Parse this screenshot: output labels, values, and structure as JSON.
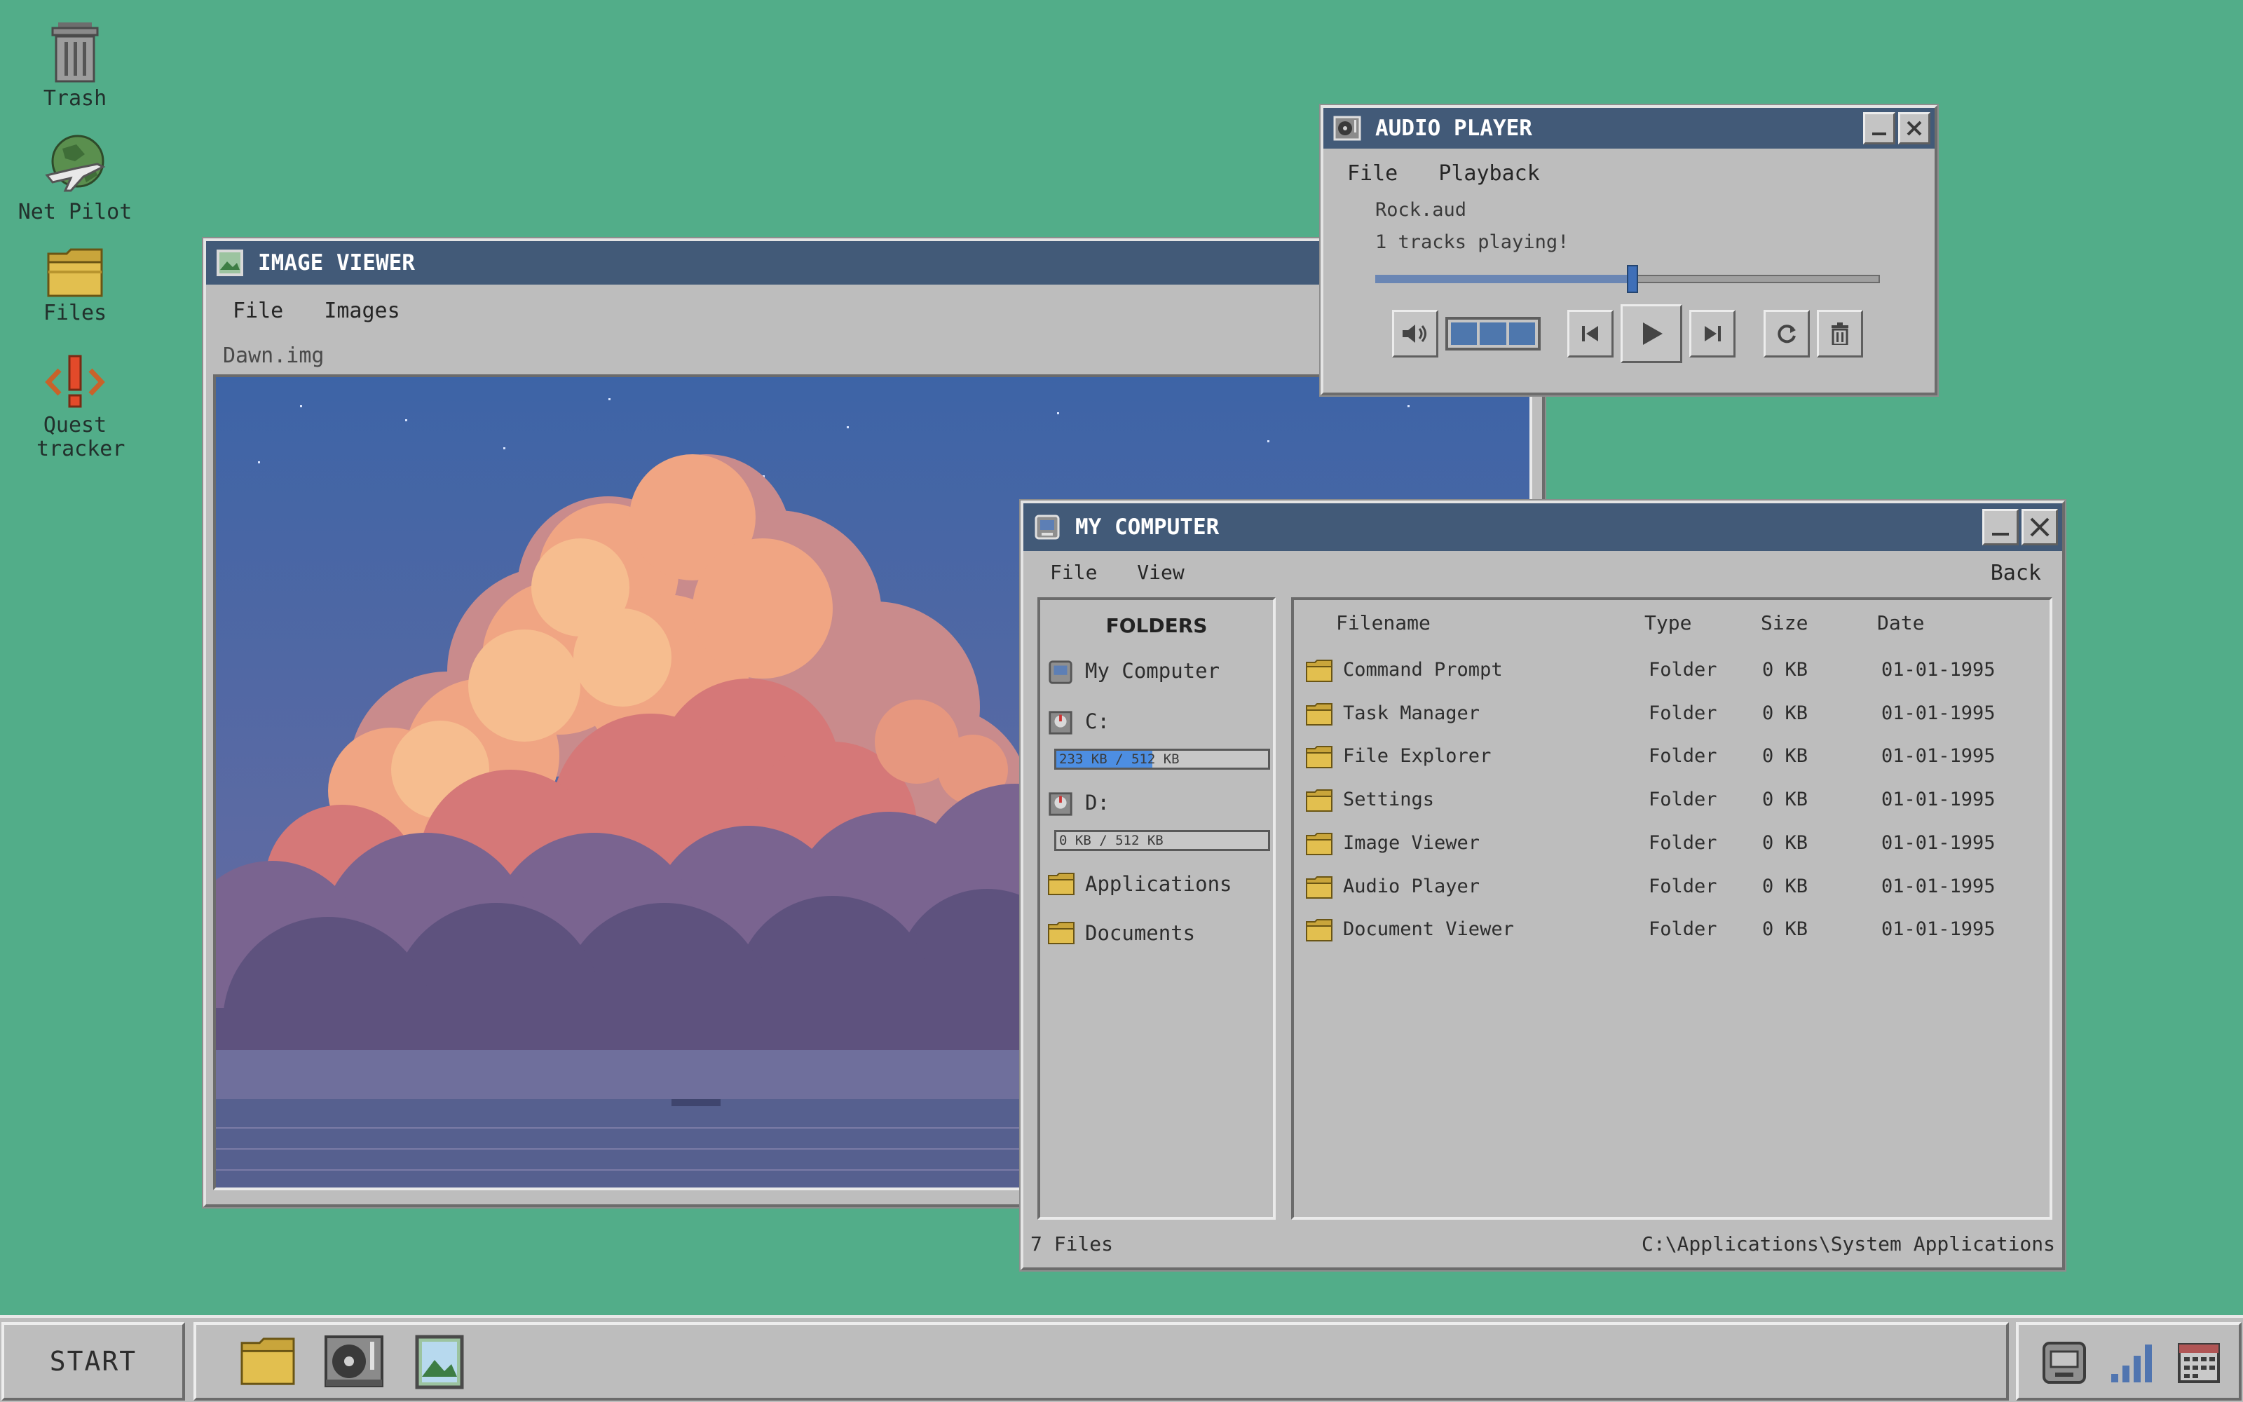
{
  "desktop": {
    "icons": [
      {
        "label": "Trash"
      },
      {
        "label": "Net Pilot"
      },
      {
        "label": "Files"
      },
      {
        "label": "Quest tracker"
      }
    ]
  },
  "image_viewer": {
    "title": "IMAGE VIEWER",
    "menu": [
      "File",
      "Images"
    ],
    "filename": "Dawn.img"
  },
  "audio_player": {
    "title": "AUDIO PLAYER",
    "menu": [
      "File",
      "Playback"
    ],
    "track": "Rock.aud",
    "status": "1 tracks playing!",
    "progress_fraction": 0.51,
    "volume_level": "3 of 3"
  },
  "my_computer": {
    "title": "MY COMPUTER",
    "menu": [
      "File",
      "View"
    ],
    "back_label": "Back",
    "folders_heading": "FOLDERS",
    "sidebar": {
      "my_computer": "My Computer",
      "drive_c": {
        "label": "C:",
        "usage_text": "233 KB / 512 KB",
        "used_fraction": 0.455
      },
      "drive_d": {
        "label": "D:",
        "usage_text": "0 KB / 512 KB",
        "used_fraction": 0.0
      },
      "applications": "Applications",
      "documents": "Documents"
    },
    "columns": [
      "Filename",
      "Type",
      "Size",
      "Date"
    ],
    "rows": [
      {
        "name": "Command Prompt",
        "type": "Folder",
        "size": "0 KB",
        "date": "01-01-1995"
      },
      {
        "name": "Task Manager",
        "type": "Folder",
        "size": "0 KB",
        "date": "01-01-1995"
      },
      {
        "name": "File Explorer",
        "type": "Folder",
        "size": "0 KB",
        "date": "01-01-1995"
      },
      {
        "name": "Settings",
        "type": "Folder",
        "size": "0 KB",
        "date": "01-01-1995"
      },
      {
        "name": "Image Viewer",
        "type": "Folder",
        "size": "0 KB",
        "date": "01-01-1995"
      },
      {
        "name": "Audio Player",
        "type": "Folder",
        "size": "0 KB",
        "date": "01-01-1995"
      },
      {
        "name": "Document Viewer",
        "type": "Folder",
        "size": "0 KB",
        "date": "01-01-1995"
      }
    ],
    "status_count": "7 Files",
    "status_path": "C:\\Applications\\System Applications"
  },
  "taskbar": {
    "start_label": "START"
  },
  "colors": {
    "desktop": "#52ad89",
    "titlebar": "#425a78",
    "window": "#bdbdbd",
    "accent_blue": "#4d8ee2"
  }
}
